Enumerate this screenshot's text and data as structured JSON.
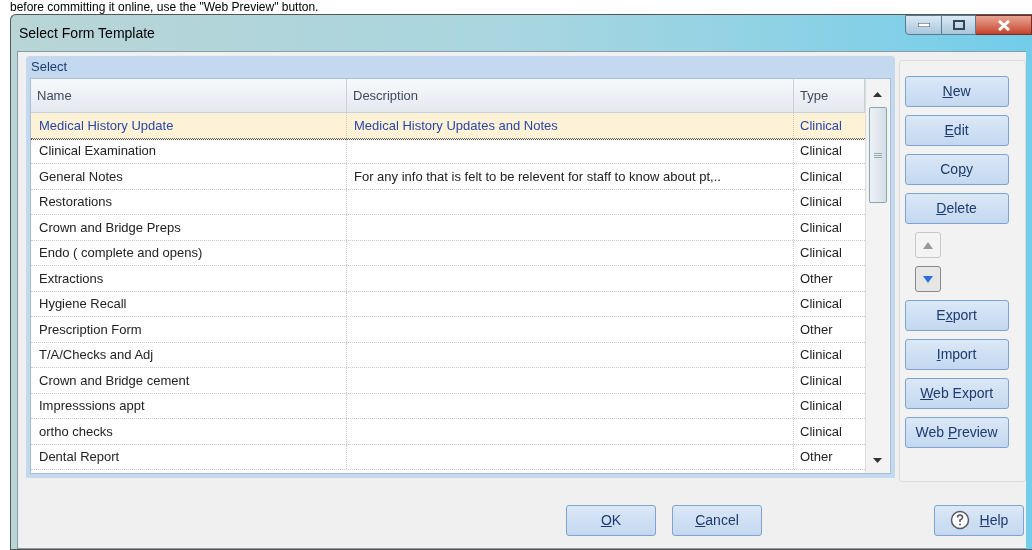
{
  "background_text": "before committing it online, use the \"Web Preview\" button.",
  "window": {
    "title": "Select Form Template"
  },
  "group": {
    "title": "Select"
  },
  "table": {
    "columns": [
      "Name",
      "Description",
      "Type"
    ],
    "rows": [
      {
        "name": "Medical History Update",
        "description": "Medical History Updates and Notes",
        "type": "Clinical",
        "selected": true
      },
      {
        "name": "Clinical Examination",
        "type": "Clinical",
        "selected": false
      },
      {
        "name": "General Notes",
        "description": "For any info that is felt to be relevent for staff to know about pt,..",
        "type": "Clinical",
        "selected": false
      },
      {
        "name": "Restorations",
        "type": "Clinical",
        "selected": false
      },
      {
        "name": "Crown and Bridge Preps",
        "type": "Clinical",
        "selected": false
      },
      {
        "name": "Endo ( complete and opens)",
        "type": "Clinical",
        "selected": false
      },
      {
        "name": "Extractions",
        "type": "Other",
        "selected": false
      },
      {
        "name": "Hygiene Recall",
        "type": "Clinical",
        "selected": false
      },
      {
        "name": "Prescription Form",
        "type": "Other",
        "selected": false
      },
      {
        "name": "T/A/Checks and Adj",
        "type": "Clinical",
        "selected": false
      },
      {
        "name": "Crown and Bridge cement",
        "type": "Clinical",
        "selected": false
      },
      {
        "name": "Impresssions appt",
        "type": "Clinical",
        "selected": false
      },
      {
        "name": "ortho checks",
        "type": "Clinical",
        "selected": false
      },
      {
        "name": "Dental Report",
        "type": "Other",
        "selected": false
      }
    ]
  },
  "side_buttons": [
    {
      "kind": "text",
      "key": "N",
      "post": "ew"
    },
    {
      "kind": "text",
      "key": "E",
      "post": "dit"
    },
    {
      "kind": "text",
      "pre": "Co",
      "key": "p",
      "post": "y"
    },
    {
      "kind": "text",
      "key": "D",
      "post": "elete"
    },
    {
      "kind": "move_up",
      "disabled": true
    },
    {
      "kind": "move_down",
      "disabled": false
    },
    {
      "kind": "text",
      "pre": "E",
      "key": "x",
      "post": "port"
    },
    {
      "kind": "text",
      "key": "I",
      "post": "mport"
    },
    {
      "kind": "text",
      "key": "W",
      "post": "eb Export"
    },
    {
      "kind": "text",
      "pre": "Web ",
      "key": "P",
      "post": "review"
    }
  ],
  "footer_buttons": [
    {
      "kind": "text",
      "key": "O",
      "post": "K"
    },
    {
      "kind": "text",
      "key": "C",
      "post": "ancel"
    }
  ],
  "help_button": {
    "key": "H",
    "post": "elp"
  }
}
